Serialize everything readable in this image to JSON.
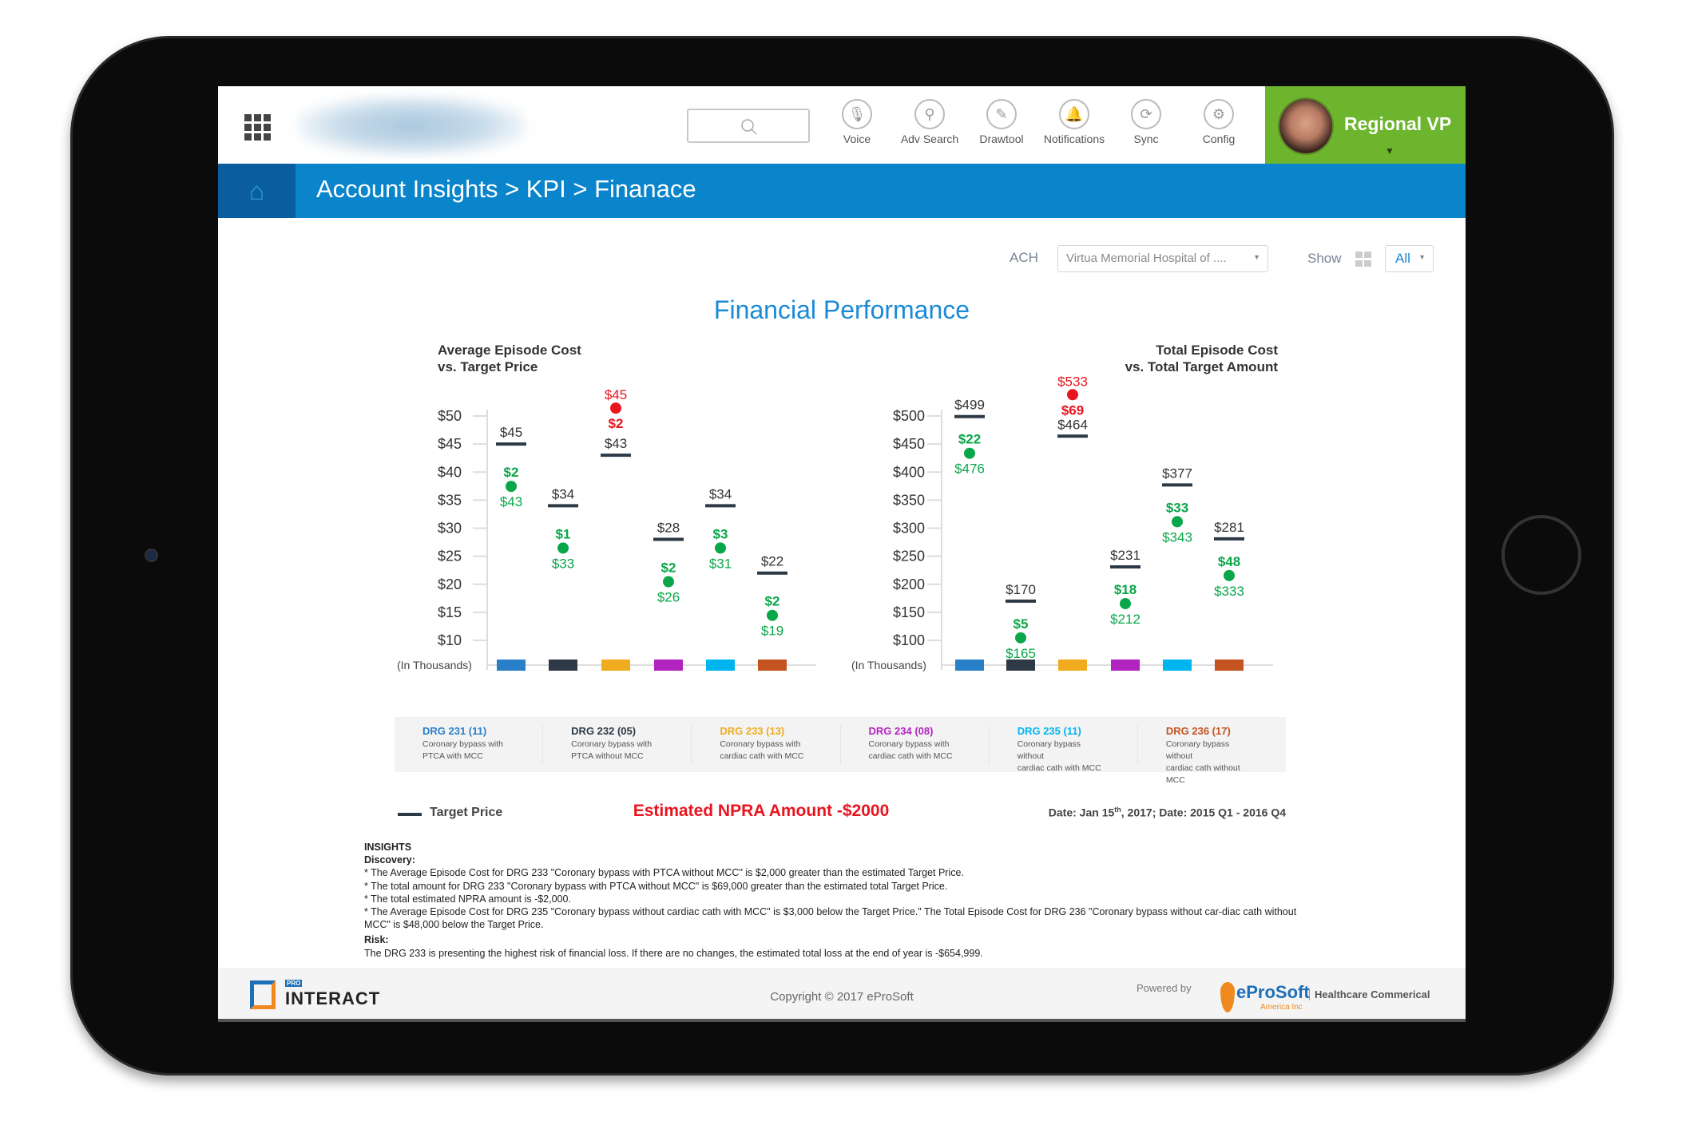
{
  "header": {
    "user_name": "Regional VP",
    "toolbar": [
      {
        "label": "Voice",
        "icon": "microphone-icon"
      },
      {
        "label": "Adv Search",
        "icon": "search-icon"
      },
      {
        "label": "Drawtool",
        "icon": "pencil-icon"
      },
      {
        "label": "Notifications",
        "icon": "bell-icon"
      },
      {
        "label": "Sync",
        "icon": "sync-icon"
      },
      {
        "label": "Config",
        "icon": "document-gear-icon"
      }
    ]
  },
  "breadcrumb": "Account Insights > KPI > Finanace",
  "filters": {
    "ach_label": "ACH",
    "ach_value": "Virtua Memorial Hospital of ....",
    "show_label": "Show",
    "show_value": "All"
  },
  "page_title": "Financial Performance",
  "colors": {
    "green": "#0aa64a",
    "red": "#e8141e",
    "target": "#2d3a46",
    "drg": [
      "#2a7fc9",
      "#2d3a46",
      "#f0ac1e",
      "#b224c0",
      "#00b5ef",
      "#c4531f"
    ]
  },
  "chart_data": [
    {
      "type": "dot-vs-target",
      "title_line1": "Average Episode Cost",
      "title_line2": "vs. Target Price",
      "unit_label": "(In Thousands)",
      "ylim": [
        10,
        50
      ],
      "yticks": [
        "$50",
        "$45",
        "$40",
        "$35",
        "$30",
        "$25",
        "$20",
        "$15",
        "$10"
      ],
      "categories": [
        "DRG 231",
        "DRG 232",
        "DRG 233",
        "DRG 234",
        "DRG 235",
        "DRG 236"
      ],
      "target": [
        45,
        34,
        43,
        28,
        34,
        22
      ],
      "actual": [
        43,
        33,
        45,
        26,
        31,
        19
      ],
      "difference": [
        2,
        1,
        2,
        2,
        3,
        2
      ],
      "status": [
        "below",
        "below",
        "above",
        "below",
        "below",
        "below"
      ],
      "target_labels": [
        "$45",
        "$34",
        "$43",
        "$28",
        "$34",
        "$22"
      ],
      "actual_labels": [
        "$43",
        "$33",
        "$45",
        "$26",
        "$31",
        "$19"
      ],
      "diff_labels": [
        "$2",
        "$1",
        "$2",
        "$2",
        "$3",
        "$2"
      ]
    },
    {
      "type": "dot-vs-target",
      "title_line1": "Total Episode Cost",
      "title_line2": "vs. Total Target Amount",
      "unit_label": "(In Thousands)",
      "ylim": [
        100,
        500
      ],
      "yticks": [
        "$500",
        "$450",
        "$400",
        "$350",
        "$300",
        "$250",
        "$200",
        "$150",
        "$100"
      ],
      "categories": [
        "DRG 231",
        "DRG 232",
        "DRG 233",
        "DRG 234",
        "DRG 235",
        "DRG 236"
      ],
      "target": [
        499,
        170,
        464,
        231,
        377,
        281
      ],
      "actual": [
        476,
        165,
        533,
        212,
        343,
        333
      ],
      "difference": [
        22,
        5,
        69,
        18,
        33,
        48
      ],
      "status": [
        "below",
        "below",
        "above",
        "below",
        "below",
        "below"
      ],
      "target_labels": [
        "$499",
        "$170",
        "$464",
        "$231",
        "$377",
        "$281"
      ],
      "actual_labels": [
        "$476",
        "$165",
        "$533",
        "$212",
        "$343",
        "$333"
      ],
      "diff_labels": [
        "$22",
        "$5",
        "$69",
        "$18",
        "$33",
        "$48"
      ]
    }
  ],
  "legend": [
    {
      "code": "DRG 231 (11)",
      "line1": "Coronary bypass with",
      "line2": "PTCA with MCC"
    },
    {
      "code": "DRG 232 (05)",
      "line1": "Coronary bypass with",
      "line2": "PTCA without MCC"
    },
    {
      "code": "DRG 233 (13)",
      "line1": "Coronary bypass with",
      "line2": "cardiac cath with MCC"
    },
    {
      "code": "DRG 234 (08)",
      "line1": "Coronary bypass with",
      "line2": "cardiac cath with MCC"
    },
    {
      "code": "DRG 235 (11)",
      "line1": "Coronary bypass without",
      "line2": "cardiac cath with MCC"
    },
    {
      "code": "DRG 236 (17)",
      "line1": "Coronary bypass without",
      "line2": "cardiac cath without MCC"
    }
  ],
  "target_price_label": "Target Price",
  "npra": "Estimated NPRA Amount -$2000",
  "date": {
    "pre": "Date: Jan 15",
    "sup": "th",
    "post": ", 2017; Date: 2015 Q1 - 2016 Q4"
  },
  "insights": {
    "heading": "INSIGHTS",
    "discovery_label": "Discovery:",
    "discovery": [
      "* The Average Episode Cost for DRG 233 \"Coronary bypass with PTCA without MCC\" is $2,000 greater than the estimated Target Price.",
      "* The total amount for DRG 233 \"Coronary bypass with PTCA without MCC\" is $69,000 greater than the estimated total Target Price.",
      "* The total estimated NPRA amount is -$2,000.",
      "* The Average Episode Cost for DRG 235 \"Coronary bypass without cardiac cath with MCC\" is $3,000 below the Target Price.\" The Total Episode Cost for DRG 236 \"Coronary bypass without car-diac cath without MCC\" is $48,000 below the Target Price."
    ],
    "risk_label": "Risk:",
    "risk": "The DRG 233 is presenting the highest risk of financial loss. If there are no changes, the estimated total loss at the end of year is -$654,999."
  },
  "footer": {
    "brand_pro": "PRO",
    "brand_name": "INTERACT",
    "copyright": "Copyright © 2017 eProSoft",
    "powered_by": "Powered by",
    "eprosoft": "eProSoft",
    "eprosoft_sub": "America Inc",
    "division": "Healthcare Commerical"
  }
}
